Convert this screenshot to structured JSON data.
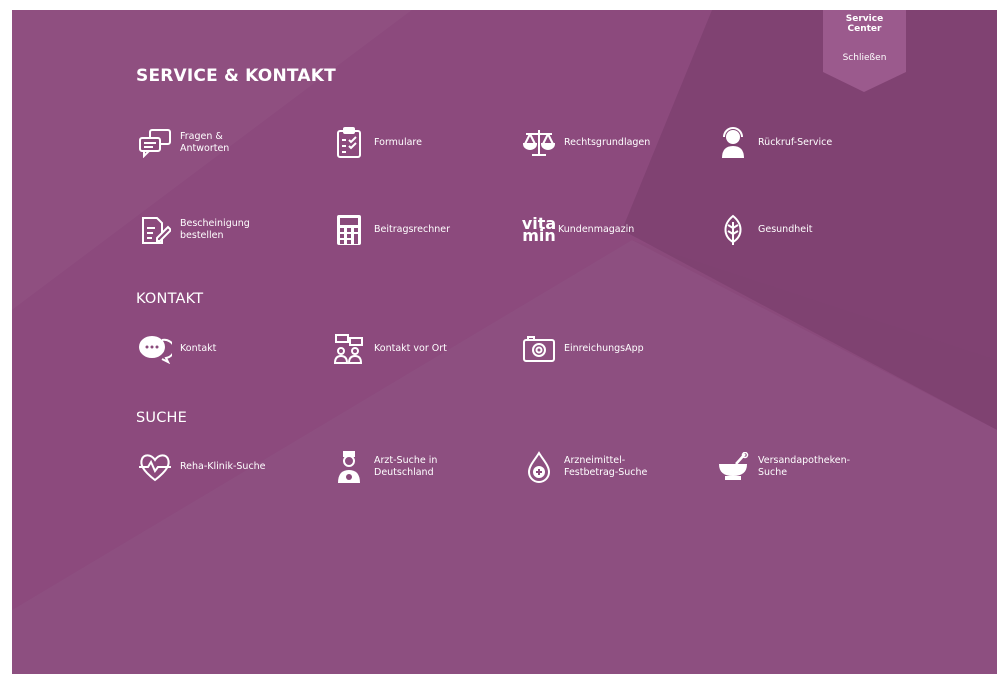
{
  "badge": {
    "title_line1": "Service",
    "title_line2": "Center",
    "close_label": "Schließen"
  },
  "sections": {
    "service": {
      "heading": "SERVICE & KONTAKT"
    },
    "kontakt": {
      "heading": "KONTAKT"
    },
    "suche": {
      "heading": "SUCHE"
    }
  },
  "items": {
    "faq": {
      "line1": "Fragen &",
      "line2": "Antworten",
      "icon": "speech-bubbles-icon"
    },
    "formulare": {
      "line1": "Formulare",
      "icon": "clipboard-icon"
    },
    "rechtsgrundlagen": {
      "line1": "Rechtsgrundlagen",
      "icon": "scales-icon"
    },
    "rueckruf": {
      "line1": "Rückruf-Service",
      "icon": "headset-person-icon"
    },
    "bescheinigung": {
      "line1": "Bescheinigung",
      "line2": "bestellen",
      "icon": "document-pen-icon"
    },
    "beitragsrechner": {
      "line1": "Beitragsrechner",
      "icon": "calculator-icon"
    },
    "kundenmagazin": {
      "logo_top": "vita",
      "logo_bottom": "min",
      "line1": "Kundenmagazin",
      "icon": "vitamin-logo-icon"
    },
    "gesundheit": {
      "line1": "Gesundheit",
      "icon": "leaf-icon"
    },
    "kontakt": {
      "line1": "Kontakt",
      "icon": "chat-icon"
    },
    "kontakt_vor_ort": {
      "line1": "Kontakt vor Ort",
      "icon": "people-location-icon"
    },
    "einreichungsapp": {
      "line1": "EinreichungsApp",
      "icon": "camera-icon"
    },
    "reha": {
      "line1": "Reha-Klinik-Suche",
      "icon": "heart-pulse-icon"
    },
    "arzt": {
      "line1": "Arzt-Suche in",
      "line2": "Deutschland",
      "icon": "doctor-icon"
    },
    "arzneimittel": {
      "line1": "Arzneimittel-",
      "line2": "Festbetrag-Suche",
      "icon": "drop-plus-icon"
    },
    "versandapotheken": {
      "line1": "Versandapotheken-",
      "line2": "Suche",
      "icon": "mortar-pestle-icon"
    }
  },
  "colors": {
    "background": "#8a4a7b",
    "accent_light": "#96558a",
    "accent_dark": "#7b3d6c",
    "text": "#ffffff"
  }
}
